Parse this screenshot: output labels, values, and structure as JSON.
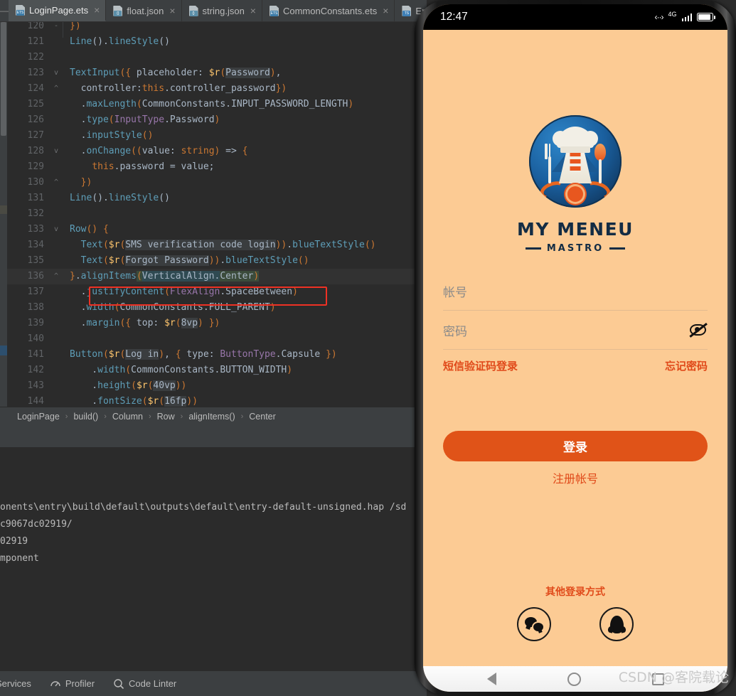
{
  "ide": {
    "tabs": [
      {
        "label": "LoginPage.ets",
        "icon": "ets-file-icon",
        "active": true
      },
      {
        "label": "float.json",
        "icon": "json-file-icon",
        "active": false
      },
      {
        "label": "string.json",
        "icon": "json-file-icon",
        "active": false
      },
      {
        "label": "CommonConstants.ets",
        "icon": "ets-file-icon",
        "active": false
      },
      {
        "label": "Ent",
        "icon": "ts-file-icon",
        "active": false
      }
    ],
    "close_glyph": "×",
    "editor": {
      "lines": [
        {
          "num": "120",
          "fold": "-"
        },
        {
          "num": "121",
          "fold": ""
        },
        {
          "num": "122",
          "fold": ""
        },
        {
          "num": "123",
          "fold": "v"
        },
        {
          "num": "124",
          "fold": "^"
        },
        {
          "num": "125",
          "fold": ""
        },
        {
          "num": "126",
          "fold": ""
        },
        {
          "num": "127",
          "fold": ""
        },
        {
          "num": "128",
          "fold": "v"
        },
        {
          "num": "129",
          "fold": ""
        },
        {
          "num": "130",
          "fold": "^"
        },
        {
          "num": "131",
          "fold": ""
        },
        {
          "num": "132",
          "fold": ""
        },
        {
          "num": "133",
          "fold": "v"
        },
        {
          "num": "134",
          "fold": ""
        },
        {
          "num": "135",
          "fold": ""
        },
        {
          "num": "136",
          "fold": "^"
        },
        {
          "num": "137",
          "fold": ""
        },
        {
          "num": "138",
          "fold": ""
        },
        {
          "num": "139",
          "fold": ""
        },
        {
          "num": "140",
          "fold": ""
        },
        {
          "num": "141",
          "fold": ""
        },
        {
          "num": "142",
          "fold": ""
        },
        {
          "num": "143",
          "fold": ""
        },
        {
          "num": "144",
          "fold": ""
        }
      ],
      "code_text": [
        "})",
        "Line().lineStyle()",
        "",
        "TextInput({ placeholder: $r(Password),",
        "  controller:this.controller_password})",
        "  .maxLength(CommonConstants.INPUT_PASSWORD_LENGTH)",
        "  .type(InputType.Password)",
        "  .inputStyle()",
        "  .onChange((value: string) => {",
        "    this.password = value;",
        "  })",
        "Line().lineStyle()",
        "",
        "Row() {",
        "  Text($r(SMS verification code login)).blueTextStyle()",
        "  Text($r(Forgot Password)).blueTextStyle()",
        "}.alignItems(VerticalAlign.Center)",
        "  .justifyContent(FlexAlign.SpaceBetween)",
        "  .width(CommonConstants.FULL_PARENT)",
        "  .margin({ top: $r(8vp) })",
        "",
        "Button($r(Log in), { type: ButtonType.Capsule })",
        "    .width(CommonConstants.BUTTON_WIDTH)",
        "    .height($r(40vp))",
        "    .fontSize($r(16fp))"
      ],
      "highlighted_line": "136",
      "highlight_box_color": "#ef3124"
    },
    "breadcrumb": {
      "separator": "›",
      "items": [
        "LoginPage",
        "build()",
        "Column",
        "Row",
        "alignItems()",
        "Center"
      ]
    },
    "console": {
      "lines": [
        "onents\\entry\\build\\default\\outputs\\default\\entry-default-unsigned.hap /sd",
        "c9067dc02919/",
        "02919",
        "mponent"
      ]
    },
    "statusbar": {
      "items": [
        {
          "label": "Services",
          "icon": "services-icon"
        },
        {
          "label": "Profiler",
          "icon": "profiler-icon"
        },
        {
          "label": "Code Linter",
          "icon": "code-linter-icon"
        }
      ]
    }
  },
  "phone": {
    "status": {
      "time": "12:47",
      "network_icon": "‹··›",
      "network_label": "4G",
      "signal_icon": "signal-bars-icon",
      "battery_icon": "battery-icon"
    },
    "logo": {
      "title": "MY MENEU",
      "subtitle": "MASTRO",
      "emblem": "chef-emblem-icon"
    },
    "form": {
      "account_placeholder": "帐号",
      "password_placeholder": "密码",
      "eye_icon": "eye-off-icon",
      "sms_login_link": "短信验证码登录",
      "forgot_password_link": "忘记密码",
      "login_button": "登录",
      "register_link": "注册帐号",
      "accent_color": "#e05318"
    },
    "other_login": {
      "title": "其他登录方式",
      "methods": [
        {
          "name": "wechat-icon"
        },
        {
          "name": "qq-icon"
        }
      ]
    },
    "navbar": {
      "back_icon": "nav-back-icon",
      "home_icon": "nav-home-icon",
      "recent_icon": "nav-recent-icon"
    },
    "watermark": "CSDN @客院载论"
  }
}
